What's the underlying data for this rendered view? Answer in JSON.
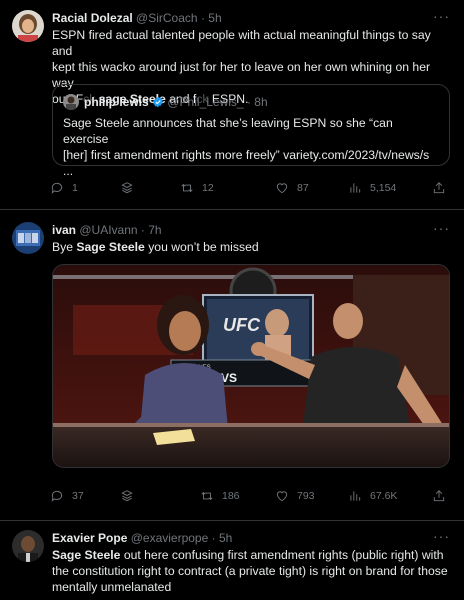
{
  "tweets": [
    {
      "name": "Racial Dolezal",
      "handle": "@SirCoach",
      "time": "· 5h",
      "text_lines": [
        "ESPN fired actual talented people with actual meaningful things to say and",
        "kept this wacko around just for her to leave on her own whining on her way"
      ],
      "text_last_pre": "out. F",
      "text_last_censor1": "ck",
      "text_last_bold": "sage Steele",
      "text_last_mid": " and f",
      "text_last_censor2": "ck",
      "text_last_end": " ESPN.",
      "quote": {
        "name": "philip lewis",
        "handle": "@Phil_Lewis_",
        "time": "· 8h",
        "line1": "Sage Steele announces that she’s leaving ESPN so she “can exercise",
        "line2": "[her] first amendment rights more freely” variety.com/2023/tv/news/s",
        "line3": "..."
      },
      "reply_count": "1",
      "retweet_count": "12",
      "like_count": "87",
      "view_count": "5,154"
    },
    {
      "name": "ivan",
      "handle": "@UAIvann",
      "time": "· 7h",
      "text_pre": "Bye ",
      "text_bold": "Sage Steele",
      "text_post": " you won’t be missed",
      "media_overlay": "UFC",
      "media_banner": "JONES VS",
      "media_banner_small": "JON JONES",
      "reply_count": "37",
      "retweet_count": "186",
      "like_count": "793",
      "view_count": "67.6K"
    },
    {
      "name": "Exavier Pope",
      "handle": "@exavierpope",
      "time": "· 5h",
      "text_bold": "Sage Steele",
      "text_line1_rest": " out here confusing first amendment rights (public right) with",
      "text_line2": "the constitution right to contract (a private tight) is right on brand for those",
      "text_line3": "mentally unmelanated"
    }
  ],
  "more_label": "···",
  "colors": {
    "bg": "#000000",
    "text": "#e7e9ea",
    "muted": "#71767b",
    "border": "#2f3336",
    "verified": "#1d9bf0"
  },
  "icons": [
    "reply-icon",
    "retweet-icon",
    "like-icon",
    "views-icon",
    "share-icon",
    "bookmark-stack-icon",
    "verified-badge-icon",
    "more-icon"
  ]
}
